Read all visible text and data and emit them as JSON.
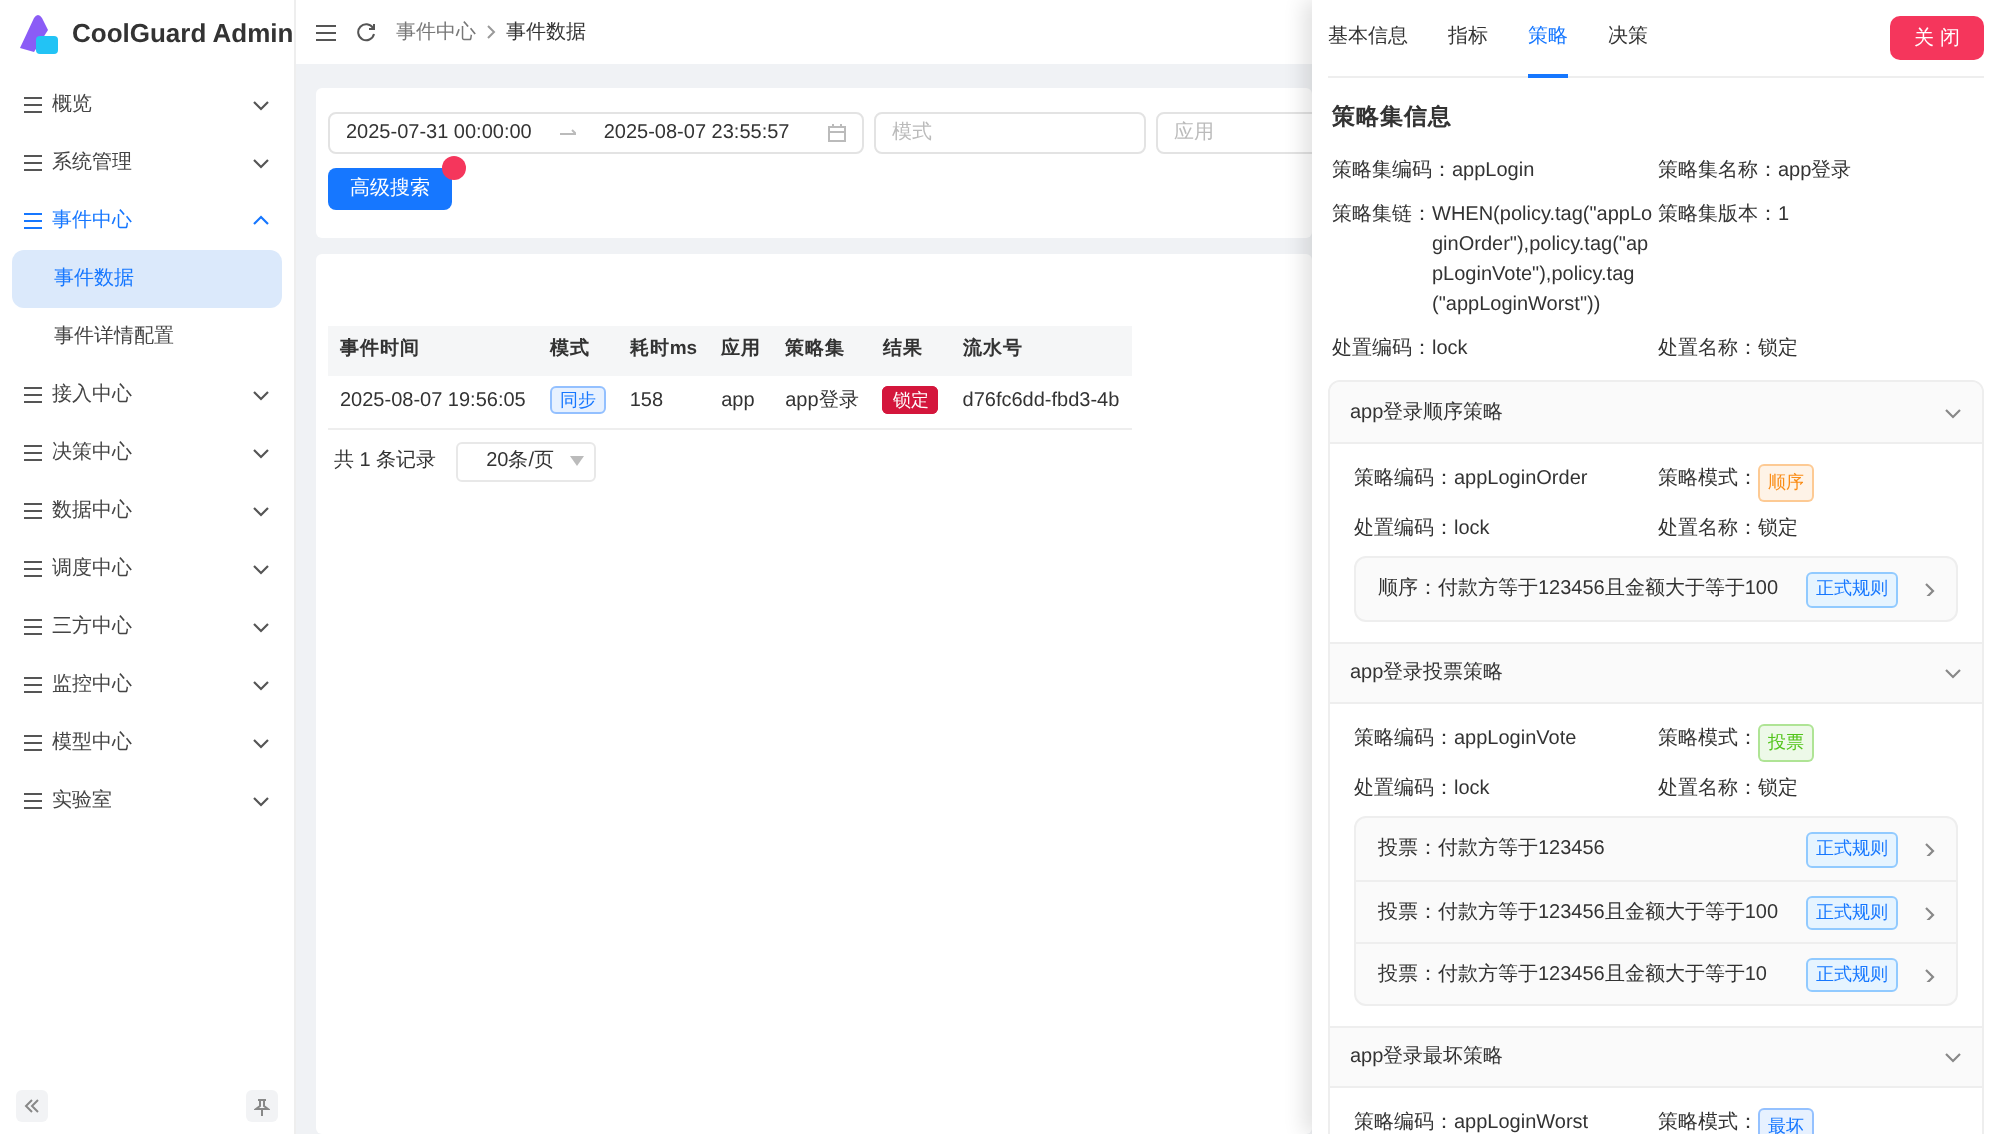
{
  "app": {
    "title": "CoolGuard Admin"
  },
  "sidebar": {
    "items": [
      {
        "label": "概览",
        "expanded": false,
        "selected": false
      },
      {
        "label": "系统管理",
        "expanded": false,
        "selected": false
      },
      {
        "label": "事件中心",
        "expanded": true,
        "selected": true,
        "children": [
          {
            "label": "事件数据",
            "selected": true
          },
          {
            "label": "事件详情配置",
            "selected": false
          }
        ]
      },
      {
        "label": "接入中心",
        "expanded": false,
        "selected": false
      },
      {
        "label": "决策中心",
        "expanded": false,
        "selected": false
      },
      {
        "label": "数据中心",
        "expanded": false,
        "selected": false
      },
      {
        "label": "调度中心",
        "expanded": false,
        "selected": false
      },
      {
        "label": "三方中心",
        "expanded": false,
        "selected": false
      },
      {
        "label": "监控中心",
        "expanded": false,
        "selected": false
      },
      {
        "label": "模型中心",
        "expanded": false,
        "selected": false
      },
      {
        "label": "实验室",
        "expanded": false,
        "selected": false
      }
    ]
  },
  "breadcrumb": [
    "事件中心",
    "事件数据"
  ],
  "filters": {
    "date_start": "2025-07-31 00:00:00",
    "date_end": "2025-08-07 23:55:57",
    "fields": [
      {
        "placeholder": "模式"
      },
      {
        "placeholder": "应用"
      }
    ],
    "search_button": "高级搜索"
  },
  "table": {
    "columns": [
      "事件时间",
      "模式",
      "耗时ms",
      "应用",
      "策略集",
      "结果",
      "流水号"
    ],
    "rows": [
      [
        {
          "text": "2025-08-07 19:56:05"
        },
        {
          "text": "同步",
          "kind": "tag",
          "color": "#1677ff"
        },
        {
          "text": "158"
        },
        {
          "text": "app"
        },
        {
          "text": "app登录"
        },
        {
          "text": "锁定",
          "kind": "solid",
          "color": "#d4163c"
        },
        {
          "text": "d76fc6dd-fbd3-4b"
        }
      ]
    ]
  },
  "pagination": {
    "total": "共 1 条记录",
    "page_size": "20条/页"
  },
  "drawer": {
    "tabs": [
      {
        "label": "基本信息",
        "selected": false
      },
      {
        "label": "指标",
        "selected": false
      },
      {
        "label": "策略",
        "selected": true
      },
      {
        "label": "决策",
        "selected": false
      }
    ],
    "close_button": "关 闭",
    "section_title": "策略集信息",
    "fields": [
      {
        "label": "策略集编码：",
        "value": "appLogin"
      },
      {
        "label": "策略集名称：",
        "value": "app登录"
      },
      {
        "label": "策略集链：",
        "value": "WHEN(policy.tag(\"appLoginOrder\"),policy.tag(\"appLoginVote\"),policy.tag(\"appLoginWorst\"))"
      },
      {
        "label": "策略集版本：",
        "value": "1"
      },
      {
        "label": "处置编码：",
        "value": "lock"
      },
      {
        "label": "处置名称：",
        "value": "锁定"
      }
    ],
    "strategies": [
      {
        "title": "app登录顺序策略",
        "expanded": true,
        "code_label": "策略编码：",
        "code": "appLoginOrder",
        "mode_label": "策略模式：",
        "mode": "顺序",
        "color": "#fa8c16",
        "disposal_code_label": "处置编码：",
        "disposal_code": "lock",
        "disposal_name_label": "处置名称：",
        "disposal_name": "锁定",
        "rules": [
          {
            "text": "顺序：付款方等于123456且金额大于等于100",
            "tag": "正式规则"
          }
        ]
      },
      {
        "title": "app登录投票策略",
        "expanded": true,
        "code_label": "策略编码：",
        "code": "appLoginVote",
        "mode_label": "策略模式：",
        "mode": "投票",
        "color": "#52c41a",
        "disposal_code_label": "处置编码：",
        "disposal_code": "lock",
        "disposal_name_label": "处置名称：",
        "disposal_name": "锁定",
        "rules": [
          {
            "text": "投票：付款方等于123456",
            "tag": "正式规则"
          },
          {
            "text": "投票：付款方等于123456且金额大于等于100",
            "tag": "正式规则"
          },
          {
            "text": "投票：付款方等于123456且金额大于等于10",
            "tag": "正式规则"
          }
        ]
      },
      {
        "title": "app登录最坏策略",
        "expanded": true,
        "code_label": "策略编码：",
        "code": "appLoginWorst",
        "mode_label": "策略模式：",
        "mode": "最坏",
        "color": "#1677ff"
      }
    ]
  }
}
